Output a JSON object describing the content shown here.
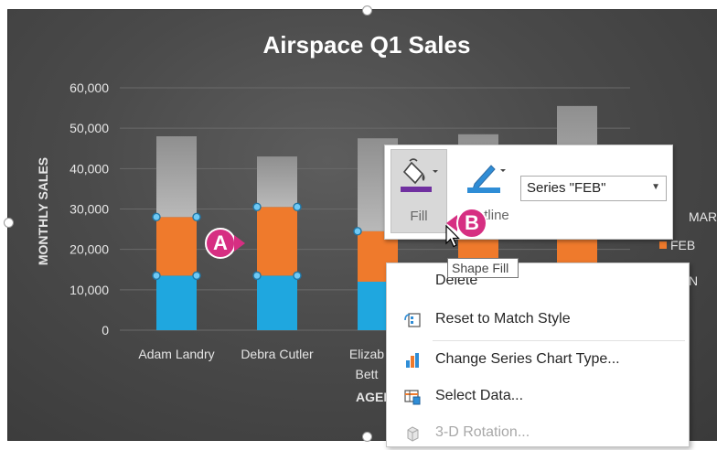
{
  "colors": {
    "jan": "#1fa7df",
    "feb": "#ef7a2c",
    "mar": "#a8a8a8",
    "callout": "#d62f82",
    "fill_accent": "#7030a0",
    "outline_accent": "#2f8dd6"
  },
  "chart_data": {
    "type": "bar",
    "stacked": true,
    "title": "Airspace Q1 Sales",
    "ylabel": "MONTHLY SALES",
    "xlabel": "AGENT",
    "ylim": [
      0,
      60000
    ],
    "yticks": [
      "60,000",
      "50,000",
      "40,000",
      "30,000",
      "20,000",
      "10,000",
      "0"
    ],
    "categories": [
      "Adam Landry",
      "Debra Cutler",
      "Elizabeth Betts",
      "",
      ""
    ],
    "category_labels_visible": [
      "Adam Landry",
      "Debra Cutler",
      "Elizab",
      "Bett"
    ],
    "xlabel_visible": "AGEI",
    "series": [
      {
        "name": "JAN",
        "values": [
          13500,
          13500,
          12000,
          12500,
          13000
        ]
      },
      {
        "name": "FEB",
        "values": [
          14500,
          17000,
          12500,
          14000,
          15000
        ]
      },
      {
        "name": "MAR",
        "values": [
          20000,
          12500,
          23000,
          22000,
          27500
        ]
      }
    ],
    "legend_visible": [
      "MAR",
      "FEB",
      "N"
    ],
    "grid": true,
    "legend_placement": "right"
  },
  "callouts": {
    "a": "A",
    "b": "B"
  },
  "mini_toolbar": {
    "fill_label": "Fill",
    "outline_label": "Outline",
    "series_value": "Series \"FEB\""
  },
  "tooltip": "Shape Fill",
  "context_menu": {
    "items": [
      {
        "label": "Delete",
        "icon": "delete-icon",
        "enabled": true
      },
      {
        "label": "Reset to Match Style",
        "icon": "reset-style-icon",
        "enabled": true
      },
      {
        "label": "Change Series Chart Type...",
        "icon": "chart-type-icon",
        "enabled": true
      },
      {
        "label": "Select Data...",
        "icon": "select-data-icon",
        "enabled": true
      },
      {
        "label": "3-D Rotation...",
        "icon": "rotation-3d-icon",
        "enabled": false
      }
    ]
  }
}
